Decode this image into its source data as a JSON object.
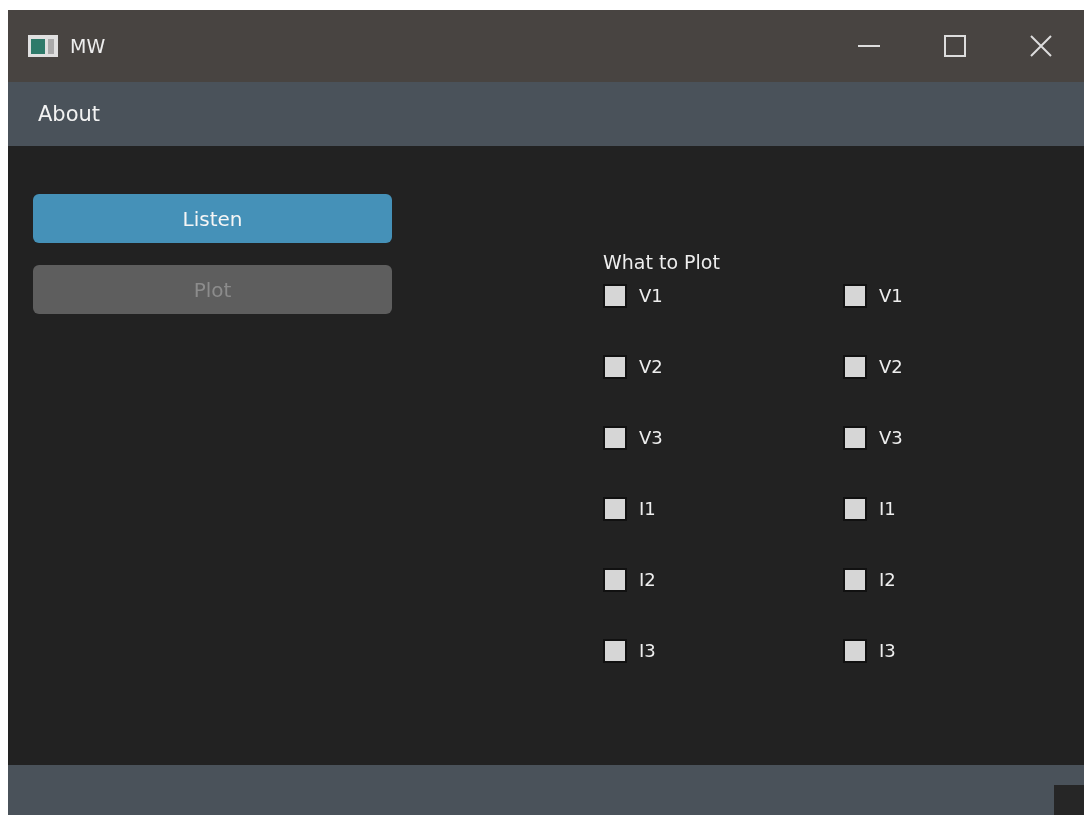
{
  "window": {
    "title": "MW"
  },
  "menu": [
    {
      "label": "About"
    }
  ],
  "buttons": [
    {
      "label": "Listen",
      "disabled": false
    },
    {
      "label": "Plot",
      "disabled": true
    }
  ],
  "plot_group": {
    "label": "What to Plot",
    "columns": [
      [
        {
          "label": "V1",
          "checked": false
        },
        {
          "label": "V2",
          "checked": false
        },
        {
          "label": "V3",
          "checked": false
        },
        {
          "label": "I1",
          "checked": false
        },
        {
          "label": "I2",
          "checked": false
        },
        {
          "label": "I3",
          "checked": false
        }
      ],
      [
        {
          "label": "V1",
          "checked": false
        },
        {
          "label": "V2",
          "checked": false
        },
        {
          "label": "V3",
          "checked": false
        },
        {
          "label": "I1",
          "checked": false
        },
        {
          "label": "I2",
          "checked": false
        },
        {
          "label": "I3",
          "checked": false
        }
      ]
    ]
  }
}
